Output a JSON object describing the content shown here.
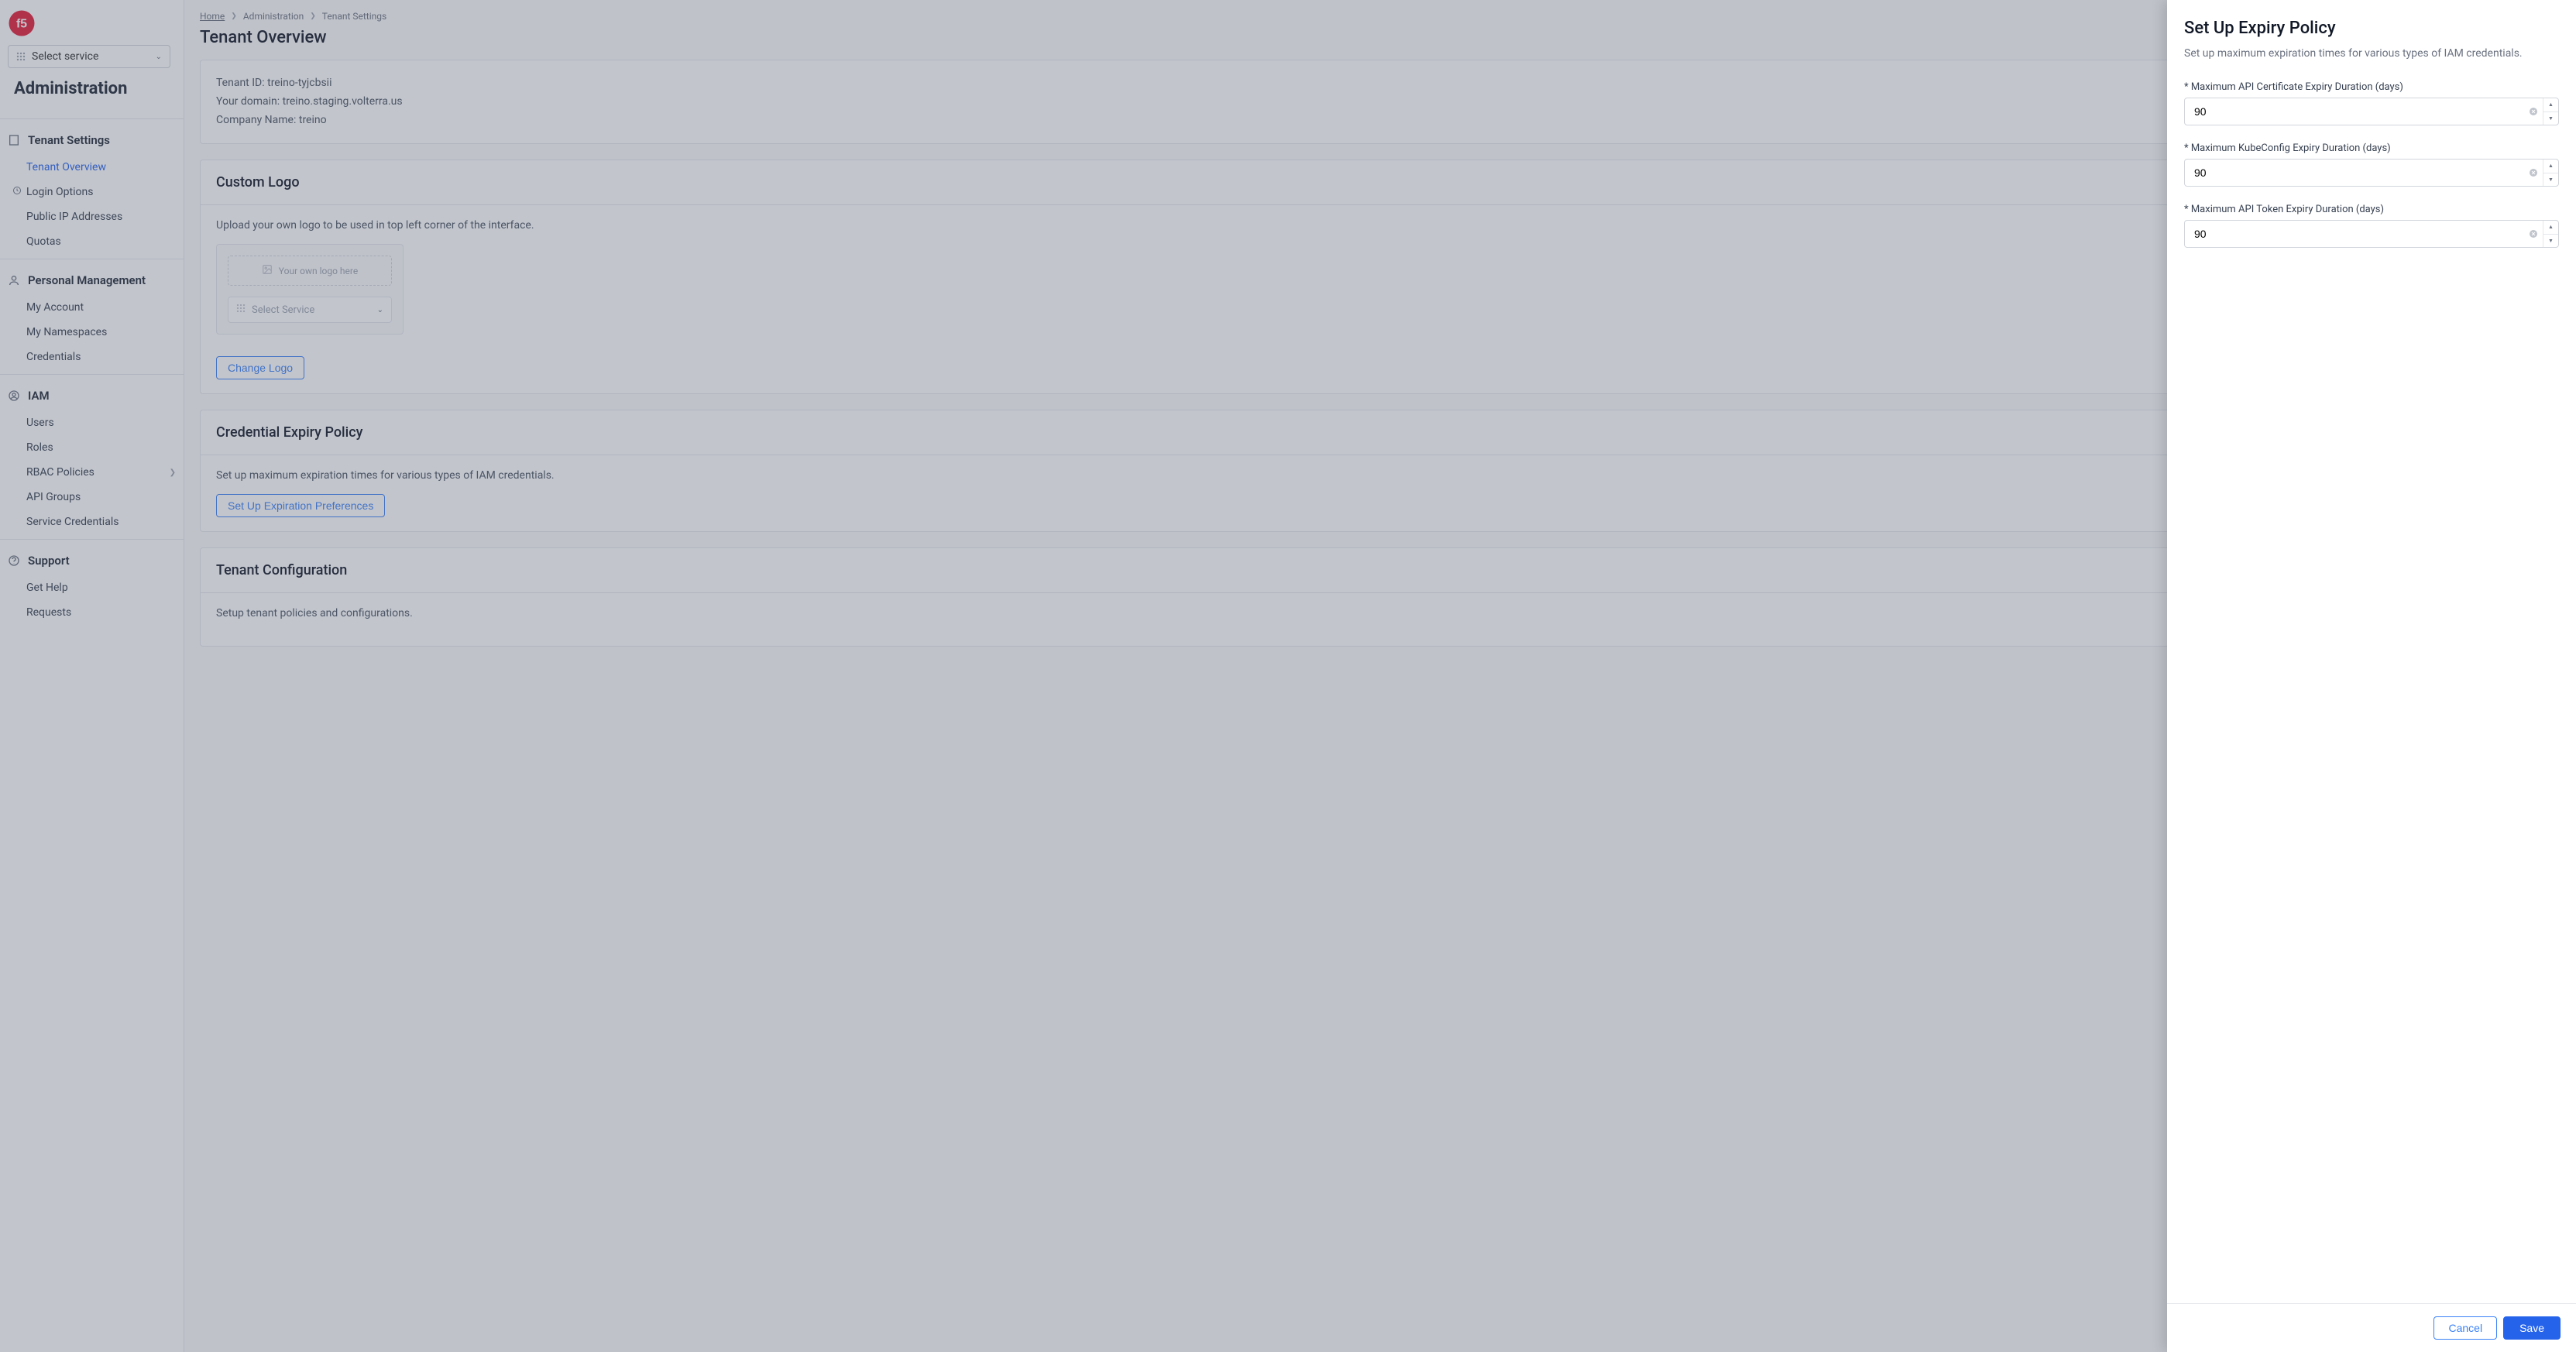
{
  "service_selector": {
    "label": "Select service"
  },
  "admin_title": "Administration",
  "sidebar": {
    "sections": [
      {
        "title": "Tenant Settings",
        "icon": "building-icon",
        "items": [
          {
            "label": "Tenant Overview",
            "active": true
          },
          {
            "label": "Login Options",
            "icon": "clock-icon"
          },
          {
            "label": "Public IP Addresses"
          },
          {
            "label": "Quotas"
          }
        ]
      },
      {
        "title": "Personal Management",
        "icon": "person-icon",
        "items": [
          {
            "label": "My Account"
          },
          {
            "label": "My Namespaces"
          },
          {
            "label": "Credentials"
          }
        ]
      },
      {
        "title": "IAM",
        "icon": "iam-icon",
        "items": [
          {
            "label": "Users"
          },
          {
            "label": "Roles"
          },
          {
            "label": "RBAC Policies",
            "chevron": true
          },
          {
            "label": "API Groups"
          },
          {
            "label": "Service Credentials"
          }
        ]
      },
      {
        "title": "Support",
        "icon": "help-icon",
        "items": [
          {
            "label": "Get Help"
          },
          {
            "label": "Requests"
          }
        ]
      }
    ]
  },
  "breadcrumbs": [
    {
      "label": "Home"
    },
    {
      "label": "Administration"
    },
    {
      "label": "Tenant Settings"
    }
  ],
  "page_title": "Tenant Overview",
  "tenant_info": {
    "tenant_id_label": "Tenant ID:",
    "tenant_id_value": "treino-tyjcbsii",
    "domain_label": "Your domain:",
    "domain_value": "treino.staging.volterra.us",
    "company_label": "Company Name:",
    "company_value": "treino"
  },
  "custom_logo": {
    "title": "Custom Logo",
    "desc": "Upload your own logo to be used in top left corner of the interface.",
    "placeholder": "Your own logo here",
    "mini_selector": "Select Service",
    "change_btn": "Change Logo"
  },
  "cred_policy": {
    "title": "Credential Expiry Policy",
    "desc": "Set up maximum expiration times for various types of IAM credentials.",
    "btn": "Set Up Expiration Preferences"
  },
  "tenant_config": {
    "title": "Tenant Configuration",
    "desc": "Setup tenant policies and configurations."
  },
  "drawer": {
    "title": "Set Up Expiry Policy",
    "desc": "Set up maximum expiration times for various types of IAM credentials.",
    "fields": [
      {
        "label": "* Maximum API Certificate Expiry Duration (days)",
        "value": "90"
      },
      {
        "label": "* Maximum KubeConfig Expiry Duration (days)",
        "value": "90"
      },
      {
        "label": "* Maximum API Token Expiry Duration (days)",
        "value": "90"
      }
    ],
    "cancel": "Cancel",
    "save": "Save"
  }
}
